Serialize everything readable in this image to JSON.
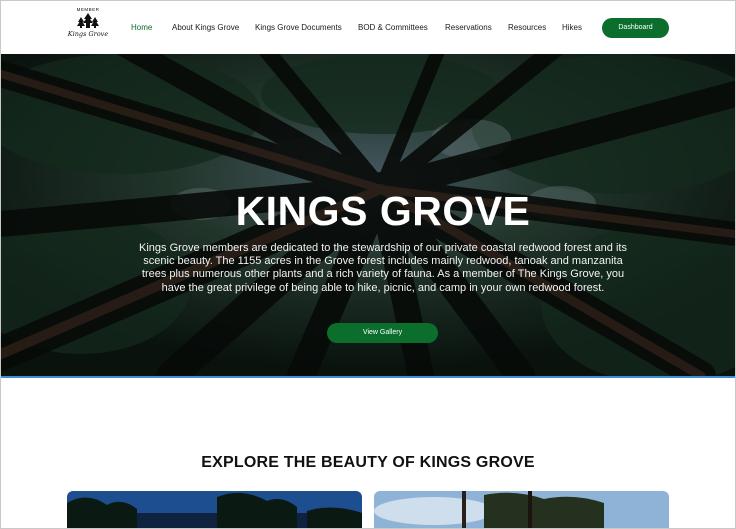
{
  "header": {
    "logo_member": "MEMBER",
    "logo_brand": "Kings Grove",
    "nav": [
      {
        "label": "Home",
        "active": true
      },
      {
        "label": "About Kings Grove"
      },
      {
        "label": "Kings Grove Documents"
      },
      {
        "label": "BOD & Committees"
      },
      {
        "label": "Reservations"
      },
      {
        "label": "Resources"
      },
      {
        "label": "Hikes"
      }
    ],
    "dashboard_label": "Dashboard"
  },
  "hero": {
    "title": "KINGS GROVE",
    "description": "Kings Grove members are dedicated to the stewardship of our private coastal redwood forest and its scenic beauty. The 1155 acres in the Grove forest includes mainly redwood, tanoak and manzanita trees plus numerous other plants and a rich variety of fauna. As a member of The Kings Grove, you have the great privilege of being able to hike, picnic, and camp in your own redwood forest.",
    "button_label": "View Gallery"
  },
  "explore": {
    "title": "EXPLORE THE BEAUTY OF KINGS GROVE"
  },
  "colors": {
    "accent": "#0b6e2d",
    "hero_border": "#3b8fd9"
  }
}
